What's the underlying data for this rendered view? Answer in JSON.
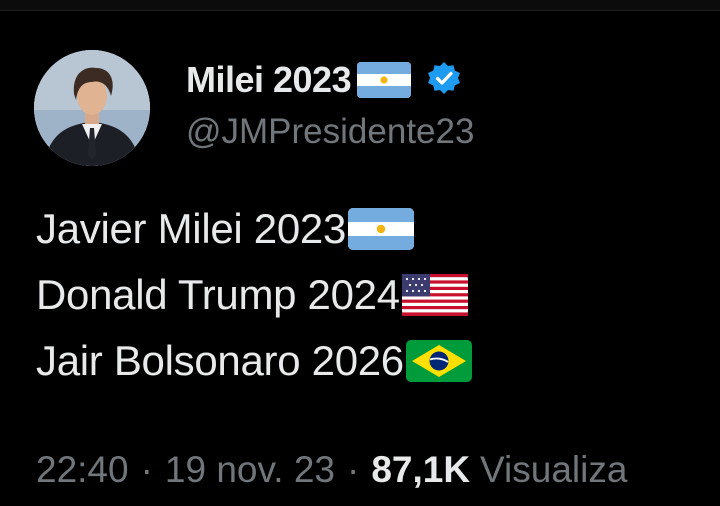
{
  "tweet": {
    "author": {
      "display_name": "Milei 2023",
      "display_name_flag": "argentina-flag-icon",
      "verified_badge": "verified-badge-icon",
      "handle": "@JMPresidente23"
    },
    "lines": [
      {
        "text": "Javier Milei 2023",
        "flag": "argentina-flag-icon"
      },
      {
        "text": "Donald Trump 2024",
        "flag": "usa-flag-icon"
      },
      {
        "text": "Jair Bolsonaro 2026",
        "flag": "brazil-flag-icon"
      }
    ],
    "meta": {
      "time": "22:40",
      "separator": "·",
      "date": "19 nov. 23",
      "views_count": "87,1K",
      "views_label": "Visualiza"
    }
  },
  "colors": {
    "background": "#000000",
    "primary_text": "#e7e9ea",
    "secondary_text": "#71767b",
    "verified_blue": "#1d9bf0"
  }
}
